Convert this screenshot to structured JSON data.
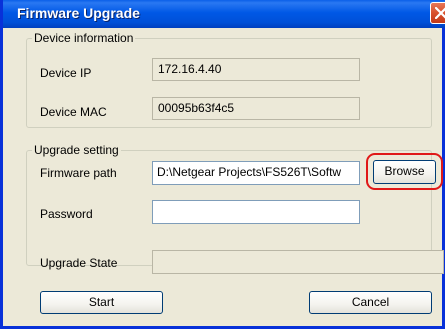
{
  "window": {
    "title": "Firmware Upgrade",
    "close_icon": "close-icon"
  },
  "device_info": {
    "group_label": "Device information",
    "ip_label": "Device IP",
    "ip_value": "172.16.4.40",
    "mac_label": "Device MAC",
    "mac_value": "00095b63f4c5"
  },
  "upgrade_setting": {
    "group_label": "Upgrade setting",
    "firmware_path_label": "Firmware path",
    "firmware_path_value": "D:\\Netgear Projects\\FS526T\\Softw",
    "browse_label": "Browse",
    "password_label": "Password",
    "password_value": ""
  },
  "upgrade_state": {
    "label": "Upgrade State",
    "value": ""
  },
  "actions": {
    "start_label": "Start",
    "cancel_label": "Cancel"
  },
  "colors": {
    "title_bar": "#0058e6",
    "dialog_bg": "#ece9d8",
    "highlight": "#e01818"
  }
}
